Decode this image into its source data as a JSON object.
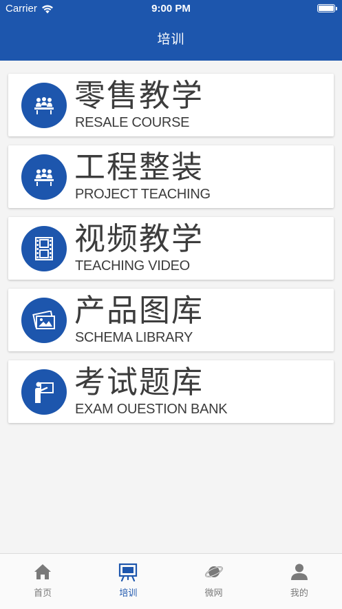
{
  "status_bar": {
    "carrier": "Carrier",
    "time": "9:00 PM",
    "battery_level": 1.0
  },
  "header": {
    "title": "培训"
  },
  "menu": [
    {
      "title": "零售教学",
      "subtitle": "RESALE COURSE",
      "icon": "meeting-icon"
    },
    {
      "title": "工程整装",
      "subtitle": "PROJECT TEACHING",
      "icon": "meeting-icon"
    },
    {
      "title": "视频教学",
      "subtitle": "TEACHING VIDEO",
      "icon": "film-icon"
    },
    {
      "title": "产品图库",
      "subtitle": "SCHEMA LIBRARY",
      "icon": "gallery-icon"
    },
    {
      "title": "考试题库",
      "subtitle": "EXAM OUESTION BANK",
      "icon": "presenter-icon"
    }
  ],
  "tabbar": [
    {
      "label": "首页",
      "icon": "home-icon",
      "active": false
    },
    {
      "label": "培训",
      "icon": "easel-icon",
      "active": true
    },
    {
      "label": "微网",
      "icon": "planet-icon",
      "active": false
    },
    {
      "label": "我的",
      "icon": "user-icon",
      "active": false
    }
  ],
  "colors": {
    "primary": "#1d56ad",
    "background": "#f4f4f4",
    "card": "#ffffff",
    "text": "#3c3c3c",
    "tab_inactive": "#7a7a7a"
  }
}
